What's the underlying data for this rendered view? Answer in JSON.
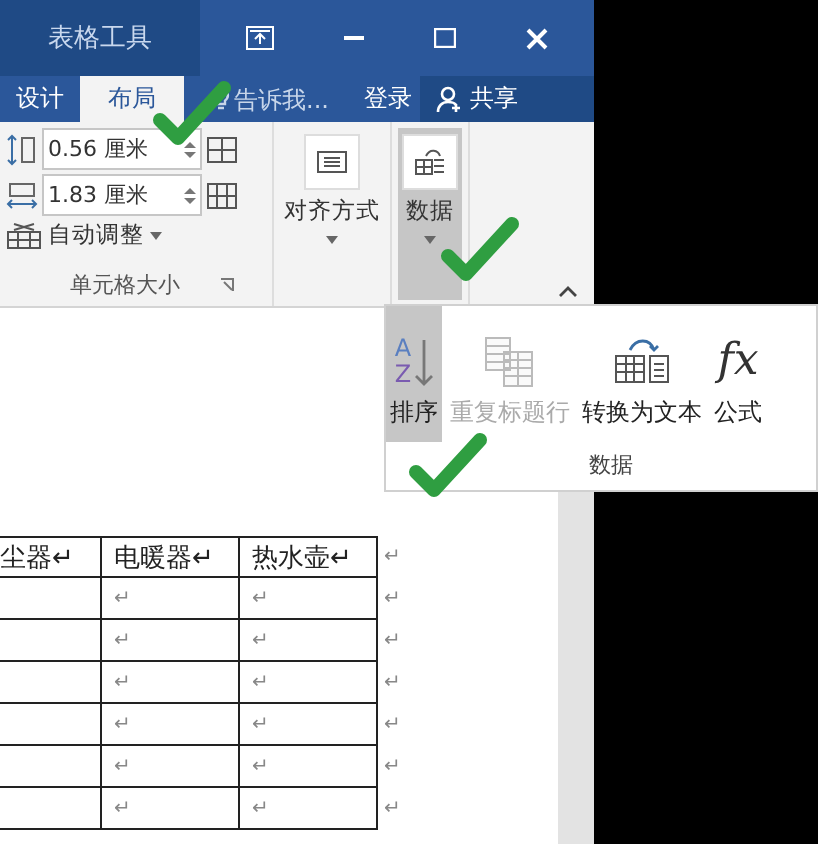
{
  "title_bar": {
    "context_tab": "表格工具"
  },
  "tabs": [
    {
      "label": "设计",
      "selected": false
    },
    {
      "label": "布局",
      "selected": true
    }
  ],
  "tell_me": {
    "placeholder": "告诉我..."
  },
  "sign_in": "登录",
  "share": "共享",
  "cell_size": {
    "height_field": "0.56 厘米",
    "width_field": "1.83 厘米",
    "autofit": "自动调整",
    "label": "单元格大小"
  },
  "ribbon_groups": [
    {
      "label": "对齐方式",
      "kind": "align",
      "pressed": false
    },
    {
      "label": "数据",
      "kind": "data",
      "pressed": true
    }
  ],
  "data_menu": {
    "label": "数据",
    "items": [
      {
        "label": "排序",
        "kind": "sort",
        "glyphs": [
          "A",
          "Z"
        ],
        "selected": true,
        "disabled": false
      },
      {
        "label": "重复标题行",
        "kind": "repeat",
        "selected": false,
        "disabled": true
      },
      {
        "label": "转换为文本",
        "kind": "convert",
        "selected": false,
        "disabled": false
      },
      {
        "label": "公式",
        "kind": "formula",
        "glyphs": [
          "fx"
        ],
        "selected": false,
        "disabled": false
      }
    ]
  },
  "table": {
    "header": {
      "cells": [
        "尘器↵",
        "电暖器↵",
        "热水壶↵"
      ],
      "end_mark": "↵"
    },
    "rows": [
      {
        "cells": [
          "↵",
          "↵"
        ],
        "end_mark": "↵"
      },
      {
        "cells": [
          "↵",
          "↵"
        ],
        "end_mark": "↵"
      },
      {
        "cells": [
          "↵",
          "↵"
        ],
        "end_mark": "↵"
      },
      {
        "cells": [
          "↵",
          "↵"
        ],
        "end_mark": "↵"
      },
      {
        "cells": [
          "↵",
          "↵"
        ],
        "end_mark": "↵"
      },
      {
        "cells": [
          "↵",
          "↵"
        ],
        "end_mark": "↵"
      }
    ]
  }
}
